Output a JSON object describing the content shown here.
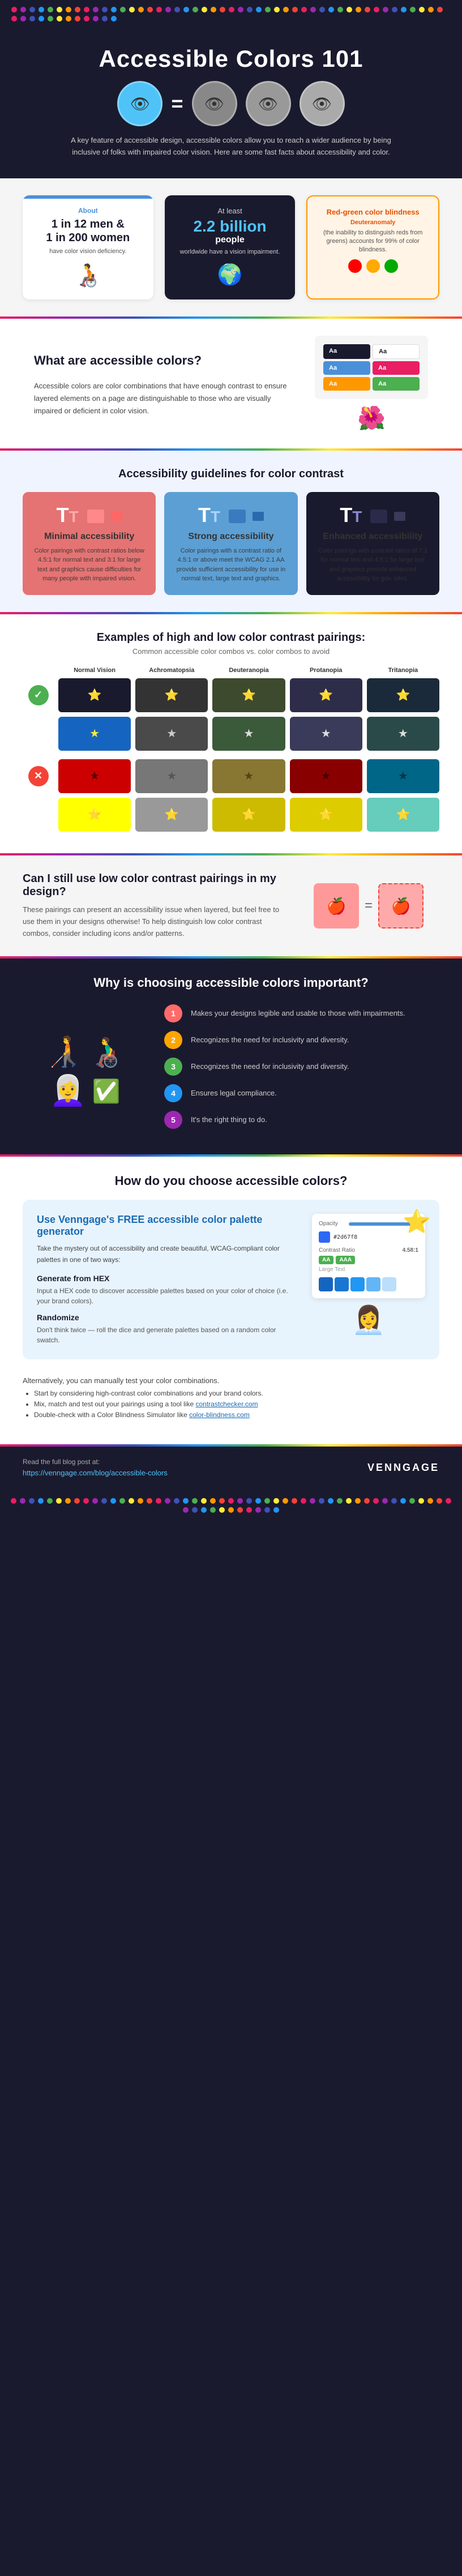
{
  "header": {
    "title_line1": "Accessible Colors 101",
    "dot_colors": [
      "#e91e63",
      "#9c27b0",
      "#3f51b5",
      "#2196f3",
      "#4caf50",
      "#ffeb3b",
      "#ff9800",
      "#f44336",
      "#e91e63",
      "#9c27b0",
      "#3f51b5",
      "#2196f3",
      "#4caf50",
      "#ffeb3b",
      "#ff9800",
      "#f44336",
      "#e91e63",
      "#9c27b0",
      "#3f51b5",
      "#2196f3",
      "#4caf50",
      "#ffeb3b",
      "#ff9800",
      "#f44336",
      "#e91e63",
      "#9c27b0",
      "#3f51b5",
      "#2196f3",
      "#4caf50",
      "#ffeb3b",
      "#ff9800",
      "#f44336"
    ],
    "description": "A key feature of accessible design, accessible colors allow you to reach a wider audience by being inclusive of folks with impaired color vision. Here are some fast facts about accessibility and color.",
    "vision_circles": [
      {
        "bg": "#4fc3f7",
        "icon": "👁"
      },
      {
        "bg": "#666",
        "icon": "👁"
      },
      {
        "bg": "#888",
        "icon": "👁"
      },
      {
        "bg": "#aaa",
        "icon": "👁"
      }
    ]
  },
  "stats": {
    "stat1": {
      "title": "About",
      "line1": "1 in 12 men &",
      "line2": "1 in 200 women",
      "line3": "have color vision deficiency."
    },
    "stat2": {
      "line1": "At least",
      "number": "2.2 billion",
      "line2": "people",
      "line3": "worldwide have a vision impairment."
    },
    "stat3": {
      "title": "Red-green color blindness",
      "subtitle": "Deuteranomaly",
      "desc": "(the inability to distinguish reds from greens) accounts for 99% of color blindness."
    }
  },
  "accessible_colors": {
    "title": "What are accessible colors?",
    "description": "Accessible colors are color combinations that have enough contrast to ensure layered elements on a page are distinguishable to those who are visually impaired or deficient in color vision."
  },
  "guidelines": {
    "title": "Accessibility guidelines for color contrast",
    "cards": [
      {
        "id": "minimal",
        "title": "Minimal accessibility",
        "desc": "Color pairings with contrast ratios below 4.5:1 for normal text and 3:1 for large text and graphics cause difficulties for many people with impaired vision.",
        "bg": "#e57373"
      },
      {
        "id": "strong",
        "title": "Strong accessibility",
        "desc": "Color pairings with a contrast ratio of 4.5:1 or above meet the WCAG 2.1 AA provide sufficient accessibility for use in normal text, large text and graphics.",
        "bg": "#5c9fd4"
      },
      {
        "id": "enhanced",
        "title": "Enhanced accessibility",
        "desc": "Color pairings with contrast ratios of 7:1 for normal text and 4.5:1 for large text and graphics provide enhanced accessibility for gov. sites.",
        "bg": "#1a1a2e"
      }
    ]
  },
  "examples": {
    "title": "Examples of high and low color contrast pairings:",
    "subtitle": "Common accessible color combos vs. color combos to avoid",
    "columns": [
      "Normal Vision",
      "Achromatopsia",
      "Deuteranopia",
      "Protanopia",
      "Tritanopia"
    ],
    "good_rows": [
      {
        "combos": [
          {
            "bg": "#1a1a2e",
            "fg": "#fff",
            "icon": "⭐"
          },
          {
            "bg": "#333",
            "fg": "#fff",
            "icon": "⭐"
          },
          {
            "bg": "#2d4a2d",
            "fg": "#fff",
            "icon": "⭐"
          },
          {
            "bg": "#2d2d4a",
            "fg": "#fff",
            "icon": "⭐"
          },
          {
            "bg": "#1a2a3a",
            "fg": "#fff",
            "icon": "⭐"
          }
        ]
      },
      {
        "combos": [
          {
            "bg": "#1565c0",
            "fg": "#ffeb3b",
            "icon": "★"
          },
          {
            "bg": "#555",
            "fg": "#ccc",
            "icon": "★"
          },
          {
            "bg": "#3a5a3a",
            "fg": "#ddd",
            "icon": "★"
          },
          {
            "bg": "#3a3a5a",
            "fg": "#ddd",
            "icon": "★"
          },
          {
            "bg": "#2a4a4a",
            "fg": "#ddd",
            "icon": "★"
          }
        ]
      }
    ],
    "bad_rows": [
      {
        "combos": [
          {
            "bg": "#cc0000",
            "fg": "#000",
            "icon": "★"
          },
          {
            "bg": "#777",
            "fg": "#555",
            "icon": "★"
          },
          {
            "bg": "#996600",
            "fg": "#443300",
            "icon": "★"
          },
          {
            "bg": "#990000",
            "fg": "#333",
            "icon": "★"
          },
          {
            "bg": "#006699",
            "fg": "#003366",
            "icon": "★"
          }
        ]
      },
      {
        "combos": [
          {
            "bg": "#ffff00",
            "fg": "#fff",
            "icon": "⭐"
          },
          {
            "bg": "#aaa",
            "fg": "#888",
            "icon": "⭐"
          },
          {
            "bg": "#ccbb00",
            "fg": "#bbaa00",
            "icon": "⭐"
          },
          {
            "bg": "#ddcc00",
            "fg": "#ccbb00",
            "icon": "⭐"
          },
          {
            "bg": "#66ccbb",
            "fg": "#55bbaa",
            "icon": "⭐"
          }
        ]
      }
    ]
  },
  "low_contrast": {
    "title": "Can I still use low color contrast pairings in my design?",
    "desc": "These pairings can present an accessibility issue when layered, but feel free to use them in your designs otherwise! To help distinguish low color contrast combos, consider including icons and/or patterns."
  },
  "why": {
    "title": "Why is choosing accessible colors important?",
    "items": [
      {
        "number": "1",
        "text": "Makes your designs legible and usable to those with impairments.",
        "color": "#ff6b6b"
      },
      {
        "number": "2",
        "text": "Recognizes the need for inclusivity and diversity.",
        "color": "#ffa500"
      },
      {
        "number": "3",
        "text": "Recognizes the need for inclusivity and diversity.",
        "color": "#4caf50"
      },
      {
        "number": "4",
        "text": "Ensures legal compliance.",
        "color": "#2196f3"
      },
      {
        "number": "5",
        "text": "It's the right thing to do.",
        "color": "#9c27b0"
      }
    ]
  },
  "how": {
    "title": "How do you choose accessible colors?",
    "generator": {
      "title": "Use Venngage's FREE accessible color palette generator",
      "desc": "Take the mystery out of accessibility and create beautiful, WCAG-compliant color palettes in one of two ways:",
      "methods": [
        {
          "title": "Generate from HEX",
          "desc": "Input a HEX code to discover accessible palettes based on your color of choice (i.e. your brand colors)."
        },
        {
          "title": "Randomize",
          "desc": "Don't think twice — roll the dice and generate palettes based on a random color swatch."
        }
      ],
      "mockup": {
        "opacity_label": "Opacity",
        "hex_value": "#2d67f8",
        "contrast_label": "Contrast Ratio",
        "contrast_value": "4.58:1",
        "aa_label": "AA",
        "aaa_label": "AAA",
        "large_text_label": "Large Text"
      }
    },
    "alternatives_title": "Alternatively, you can manually test your color combinations.",
    "alternatives_bullets": [
      "Start by considering high-contrast color combinations and your brand colors.",
      "Mix, match and test out your pairings using a tool like contrastchecker.com",
      "Double-check with a Color Blindness Simulator like color-blindness.com"
    ]
  },
  "footer": {
    "read_label": "Read the full blog post at:",
    "url": "https://venngage.com/blog/accessible-colors",
    "logo": "VENNGAGE"
  }
}
